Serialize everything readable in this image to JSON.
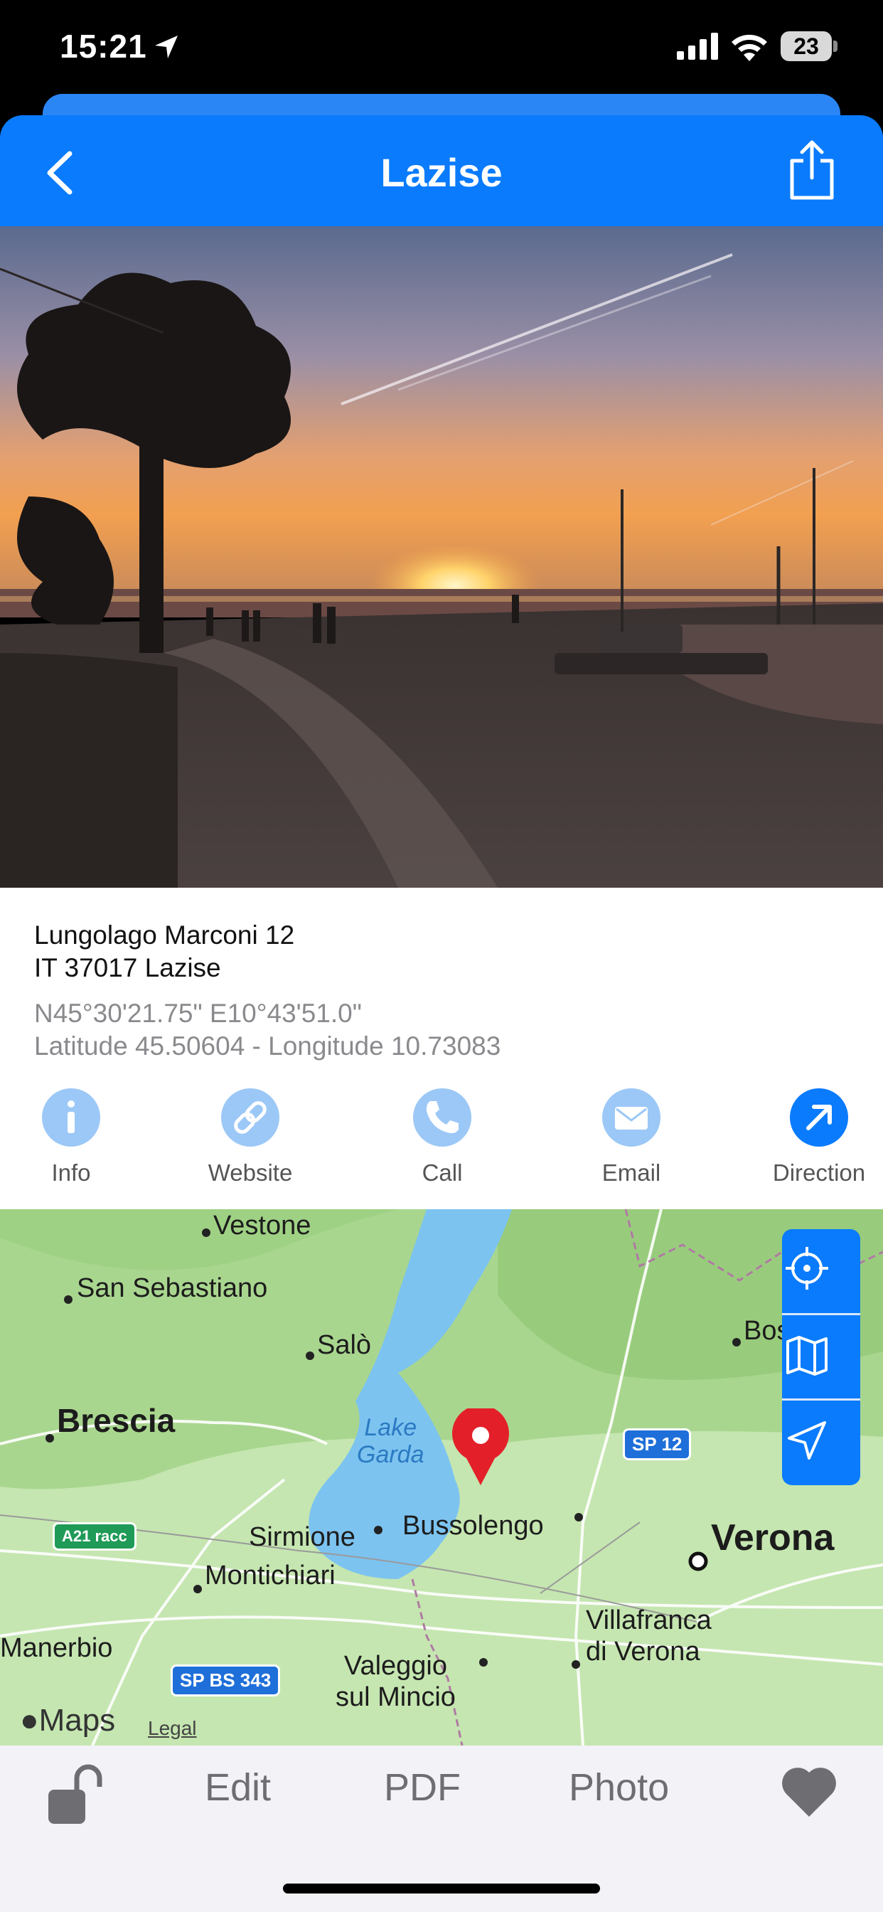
{
  "status_bar": {
    "time": "15:21",
    "battery": "23"
  },
  "nav": {
    "title": "Lazise"
  },
  "address": {
    "line1": "Lungolago Marconi 12",
    "line2": "IT 37017 Lazise",
    "dms": "N45°30'21.75\" E10°43'51.0\"",
    "decimal": "Latitude 45.50604 - Longitude 10.73083"
  },
  "actions": [
    {
      "label": "Info",
      "icon": "info-icon"
    },
    {
      "label": "Website",
      "icon": "link-icon"
    },
    {
      "label": "Call",
      "icon": "phone-icon"
    },
    {
      "label": "Email",
      "icon": "mail-icon"
    },
    {
      "label": "Direction",
      "icon": "direction-arrow-icon"
    }
  ],
  "map": {
    "places": {
      "vestone": "Vestone",
      "san_sebastiano": "San Sebastiano",
      "salo": "Salò",
      "bos": "Bos",
      "brescia": "Brescia",
      "lake": "Lake\nGarda",
      "sirmione": "Sirmione",
      "bussolengo": "Bussolengo",
      "verona": "Verona",
      "montichiari": "Montichiari",
      "villafranca": "Villafranca\ndi Verona",
      "manerbio": "Manerbio",
      "valeggio": "Valeggio\nsul Mincio"
    },
    "roads": {
      "sp12": "SP 12",
      "a21": "A21 racc",
      "spbs343": "SP BS 343"
    },
    "attribution": "Maps",
    "legal": "Legal"
  },
  "toolbar": {
    "edit": "Edit",
    "pdf": "PDF",
    "photo": "Photo"
  },
  "colors": {
    "accent": "#0a7bfc",
    "light_accent": "#9cc8f7",
    "toolbar_bg": "#f2f2f7"
  }
}
